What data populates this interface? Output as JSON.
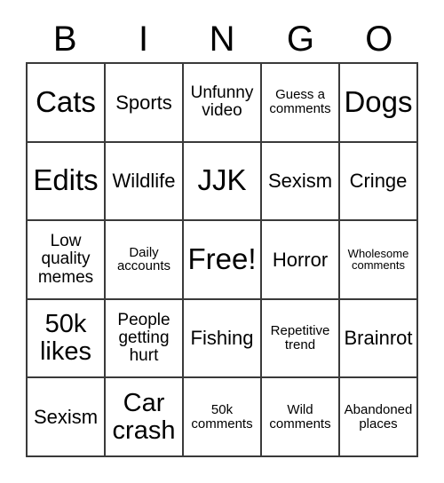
{
  "header": {
    "letters": [
      "B",
      "I",
      "N",
      "G",
      "O"
    ]
  },
  "grid": {
    "rows": 5,
    "columns": 5,
    "border_color": "#3a3a3a",
    "background_color": "#ffffff",
    "text_color": "#000000",
    "cells": [
      {
        "label": "Cats",
        "size": "xl"
      },
      {
        "label": "Sports",
        "size": "md"
      },
      {
        "label": "Unfunny\nvideo",
        "size": "sm"
      },
      {
        "label": "Guess a\ncomments",
        "size": "xs"
      },
      {
        "label": "Dogs",
        "size": "xl"
      },
      {
        "label": "Edits",
        "size": "xl"
      },
      {
        "label": "Wildlife",
        "size": "md"
      },
      {
        "label": "JJK",
        "size": "xl"
      },
      {
        "label": "Sexism",
        "size": "md"
      },
      {
        "label": "Cringe",
        "size": "md"
      },
      {
        "label": "Low\nquality\nmemes",
        "size": "sm"
      },
      {
        "label": "Daily\naccounts",
        "size": "xs"
      },
      {
        "label": "Free!",
        "size": "xl"
      },
      {
        "label": "Horror",
        "size": "md"
      },
      {
        "label": "Wholesome\ncomments",
        "size": "xxs"
      },
      {
        "label": "50k\nlikes",
        "size": "lg"
      },
      {
        "label": "People\ngetting\nhurt",
        "size": "sm"
      },
      {
        "label": "Fishing",
        "size": "md"
      },
      {
        "label": "Repetitive\ntrend",
        "size": "xs"
      },
      {
        "label": "Brainrot",
        "size": "md"
      },
      {
        "label": "Sexism",
        "size": "md"
      },
      {
        "label": "Car\ncrash",
        "size": "lg"
      },
      {
        "label": "50k\ncomments",
        "size": "xs"
      },
      {
        "label": "Wild\ncomments",
        "size": "xs"
      },
      {
        "label": "Abandoned\nplaces",
        "size": "xs"
      }
    ]
  }
}
